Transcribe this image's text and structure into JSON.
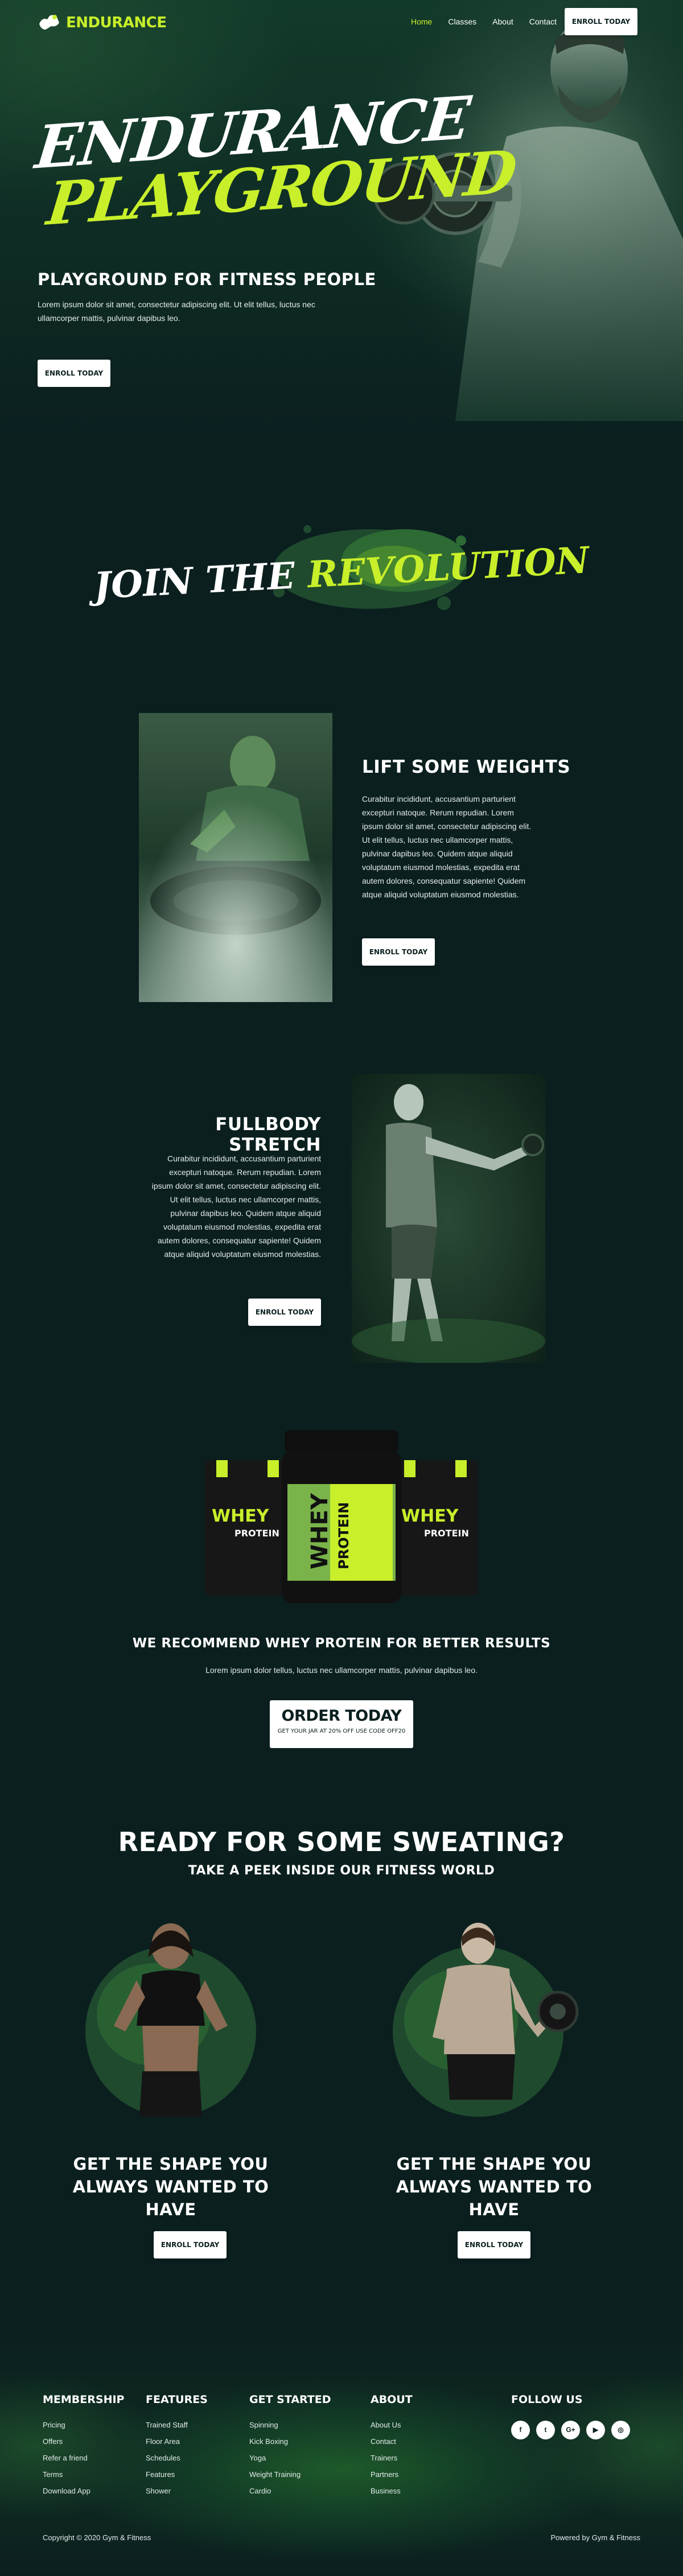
{
  "brand": {
    "name": "ENDURANCE",
    "accent": "#c8ef2a",
    "background": "#0b1f1f"
  },
  "nav": {
    "items": [
      {
        "label": "Home",
        "active": true
      },
      {
        "label": "Classes",
        "active": false
      },
      {
        "label": "About",
        "active": false
      },
      {
        "label": "Contact",
        "active": false
      }
    ],
    "cta": "ENROLL TODAY"
  },
  "hero": {
    "title_line1": "ENDURANCE",
    "title_line2": "PLAYGROUND",
    "subtitle": "PLAYGROUND FOR FITNESS PEOPLE",
    "text": "Lorem ipsum dolor sit amet, consectetur adipiscing elit. Ut elit tellus, luctus nec ullamcorper mattis, pulvinar dapibus leo.",
    "cta": "ENROLL TODAY"
  },
  "revolution": {
    "word1": "JOIN",
    "word2": "THE",
    "word3": "REVOLUTION"
  },
  "features": [
    {
      "title": "LIFT SOME WEIGHTS",
      "text": "Curabitur incididunt, accusantium parturient excepturi natoque. Rerum repudian. Lorem ipsum dolor sit amet, consectetur adipiscing elit. Ut elit tellus, luctus nec ullamcorper mattis, pulvinar dapibus leo. Quidem atque aliquid voluptatum eiusmod molestias, expedita erat autem dolores, consequatur sapiente! Quidem atque aliquid voluptatum eiusmod molestias.",
      "cta": "ENROLL TODAY"
    },
    {
      "title": "FULLBODY STRETCH",
      "text": "Curabitur incididunt, accusantium parturient excepturi natoque. Rerum repudian. Lorem ipsum dolor sit amet, consectetur adipiscing elit. Ut elit tellus, luctus nec ullamcorper mattis, pulvinar dapibus leo. Quidem atque aliquid voluptatum eiusmod molestias, expedita erat autem dolores, consequatur sapiente! Quidem atque aliquid voluptatum eiusmod molestias.",
      "cta": "ENROLL TODAY"
    }
  ],
  "product": {
    "label_line1": "WHEY",
    "label_line2": "PROTEIN",
    "title": "WE RECOMMEND WHEY PROTEIN FOR BETTER RESULTS",
    "text": "Lorem ipsum dolor tellus, luctus nec ullamcorper mattis, pulvinar dapibus leo.",
    "order_title": "ORDER TODAY",
    "order_sub": "GET YOUR JAR AT 20% OFF USE CODE OFF20"
  },
  "sweating": {
    "title": "READY FOR SOME SWEATING?",
    "subtitle": "TAKE A PEEK INSIDE OUR FITNESS WORLD",
    "cards": [
      {
        "title": "GET THE SHAPE YOU ALWAYS WANTED TO HAVE",
        "cta": "ENROLL TODAY"
      },
      {
        "title": "GET THE SHAPE YOU ALWAYS WANTED TO HAVE",
        "cta": "ENROLL TODAY"
      }
    ]
  },
  "footer": {
    "columns": [
      {
        "title": "MEMBERSHIP",
        "links": [
          "Pricing",
          "Offers",
          "Refer a friend",
          "Terms",
          "Download App"
        ]
      },
      {
        "title": "FEATURES",
        "links": [
          "Trained Staff",
          "Floor Area",
          "Schedules",
          "Features",
          "Shower"
        ]
      },
      {
        "title": "GET STARTED",
        "links": [
          "Spinning",
          "Kick Boxing",
          "Yoga",
          "Weight Training",
          "Cardio"
        ]
      },
      {
        "title": "ABOUT",
        "links": [
          "About Us",
          "Contact",
          "Trainers",
          "Partners",
          "Business"
        ]
      }
    ],
    "follow_title": "FOLLOW US",
    "social": [
      {
        "icon": "facebook-icon",
        "glyph": "f"
      },
      {
        "icon": "twitter-icon",
        "glyph": "t"
      },
      {
        "icon": "google-plus-icon",
        "glyph": "G+"
      },
      {
        "icon": "youtube-icon",
        "glyph": "▶"
      },
      {
        "icon": "instagram-icon",
        "glyph": "◎"
      }
    ],
    "copyright": "Copyright © 2020 Gym & Fitness",
    "powered": "Powered by Gym & Fitness"
  }
}
